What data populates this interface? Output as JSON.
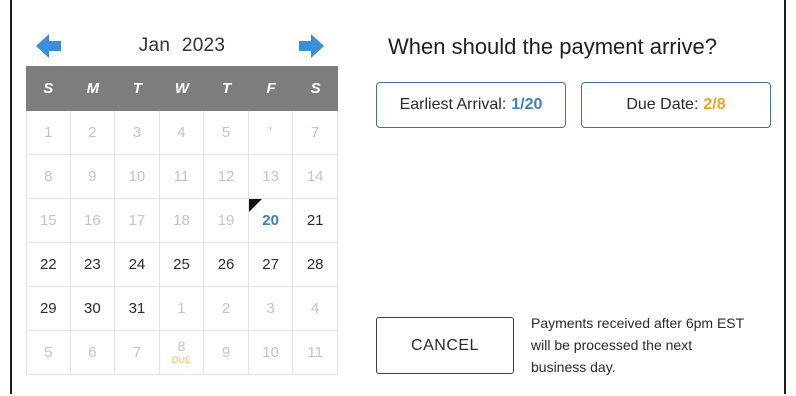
{
  "calendar": {
    "month": "Jan",
    "year": "2023",
    "prev_icon": "arrow-left-icon",
    "next_icon": "arrow-right-icon",
    "arrow_color": "#3a8fd8",
    "weekdays": [
      "S",
      "M",
      "T",
      "W",
      "T",
      "F",
      "S"
    ],
    "weeks": [
      [
        {
          "d": "1",
          "s": "inactive"
        },
        {
          "d": "2",
          "s": "inactive"
        },
        {
          "d": "3",
          "s": "inactive"
        },
        {
          "d": "4",
          "s": "inactive"
        },
        {
          "d": "5",
          "s": "inactive"
        },
        {
          "d": "'",
          "s": "inactive"
        },
        {
          "d": "7",
          "s": "inactive"
        }
      ],
      [
        {
          "d": "8",
          "s": "inactive"
        },
        {
          "d": "9",
          "s": "inactive"
        },
        {
          "d": "10",
          "s": "inactive"
        },
        {
          "d": "11",
          "s": "inactive"
        },
        {
          "d": "12",
          "s": "inactive"
        },
        {
          "d": "13",
          "s": "inactive"
        },
        {
          "d": "14",
          "s": "inactive"
        }
      ],
      [
        {
          "d": "15",
          "s": "inactive"
        },
        {
          "d": "16",
          "s": "inactive"
        },
        {
          "d": "17",
          "s": "inactive"
        },
        {
          "d": "18",
          "s": "inactive"
        },
        {
          "d": "19",
          "s": "inactive"
        },
        {
          "d": "20",
          "s": "today"
        },
        {
          "d": "21",
          "s": "active"
        }
      ],
      [
        {
          "d": "22",
          "s": "active"
        },
        {
          "d": "23",
          "s": "active"
        },
        {
          "d": "24",
          "s": "active"
        },
        {
          "d": "25",
          "s": "active"
        },
        {
          "d": "26",
          "s": "active"
        },
        {
          "d": "27",
          "s": "active"
        },
        {
          "d": "28",
          "s": "active"
        }
      ],
      [
        {
          "d": "29",
          "s": "active"
        },
        {
          "d": "30",
          "s": "active"
        },
        {
          "d": "31",
          "s": "active"
        },
        {
          "d": "1",
          "s": "inactive"
        },
        {
          "d": "2",
          "s": "inactive"
        },
        {
          "d": "3",
          "s": "inactive"
        },
        {
          "d": "4",
          "s": "inactive"
        }
      ],
      [
        {
          "d": "5",
          "s": "inactive"
        },
        {
          "d": "6",
          "s": "inactive"
        },
        {
          "d": "7",
          "s": "inactive"
        },
        {
          "d": "8",
          "s": "due",
          "label": "DUE"
        },
        {
          "d": "9",
          "s": "inactive"
        },
        {
          "d": "10",
          "s": "inactive"
        },
        {
          "d": "11",
          "s": "inactive"
        }
      ]
    ]
  },
  "question": "When should the payment arrive?",
  "earliest": {
    "label": "Earliest Arrival:",
    "value": "1/20",
    "color": "#3a7fc1"
  },
  "due": {
    "label": "Due Date:",
    "value": "2/8",
    "color": "#f0a320"
  },
  "cancel_label": "CANCEL",
  "note": "Payments received after 6pm EST will be processed the next business day."
}
